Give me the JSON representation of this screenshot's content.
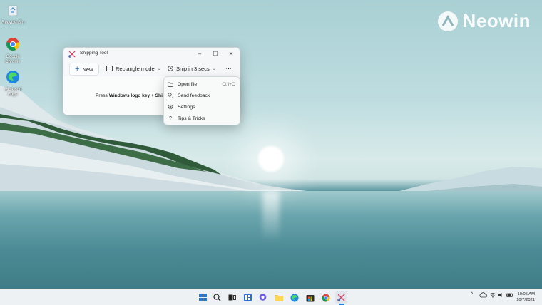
{
  "watermark": {
    "brand": "Neowin"
  },
  "desktop_icons": [
    {
      "label": "Recycle Bin",
      "icon": "recycle-bin-icon"
    },
    {
      "label": "Google Chrome",
      "icon": "chrome-icon"
    },
    {
      "label": "Microsoft Edge",
      "icon": "edge-icon"
    }
  ],
  "window": {
    "title": "Snipping Tool",
    "controls": {
      "minimize": "–",
      "maximize": "☐",
      "close": "✕"
    },
    "toolbar": {
      "new_label": "New",
      "mode_label": "Rectangle mode",
      "delay_label": "Snip in 3 secs",
      "more_label": "···"
    },
    "content": {
      "message_prefix": "Press ",
      "message_bold": "Windows logo key + Shi"
    }
  },
  "menu": {
    "items": [
      {
        "label": "Open file",
        "shortcut": "Ctrl+O",
        "icon": "folder-icon"
      },
      {
        "label": "Send feedback",
        "shortcut": "",
        "icon": "feedback-icon"
      },
      {
        "label": "Settings",
        "shortcut": "",
        "icon": "gear-icon"
      },
      {
        "label": "Tips & Tricks",
        "shortcut": "",
        "icon": "question-icon"
      }
    ]
  },
  "taskbar": {
    "apps": [
      "start-icon",
      "search-icon",
      "task-view-icon",
      "widgets-icon",
      "chat-icon",
      "file-explorer-icon",
      "edge-icon",
      "store-icon",
      "chrome-icon",
      "snipping-tool-icon"
    ],
    "clock": {
      "time": "10:05 AM",
      "date": "10/7/2021"
    }
  },
  "colors": {
    "accent": "#2a5fb8",
    "taskbar_bg": "#eef1f3",
    "window_bg": "#f5f7f8"
  }
}
